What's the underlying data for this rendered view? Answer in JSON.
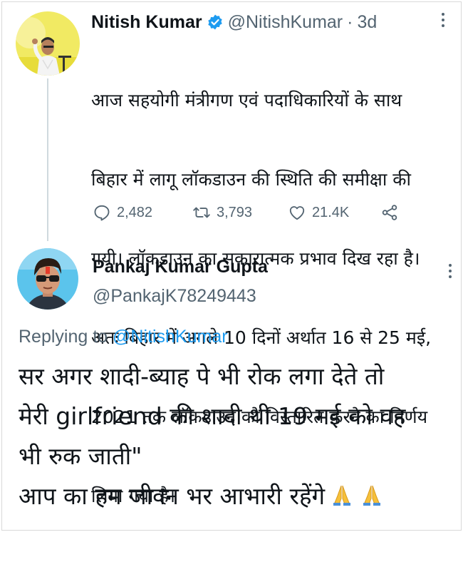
{
  "original_tweet": {
    "author_name": "Nitish Kumar",
    "handle": "@NitishKumar",
    "separator": "·",
    "time": "3d",
    "text_lines": [
      "आज सहयोगी मंत्रीगण एवं पदाधिकारियों के साथ",
      "बिहार में लागू लॉकडाउन की स्थिति की समीक्षा की",
      "गयी। लॉकडाउन का सकारात्मक प्रभाव दिख रहा है।",
      "अतः बिहार में अगले 10 दिनों अर्थात 16 से 25 मई,",
      "2021 तक लॉकडाउन को विस्तारित करने का निर्णय",
      "लिया गया है।"
    ],
    "actions": {
      "replies": "2,482",
      "retweets": "3,793",
      "likes": "21.4K"
    },
    "icons": [
      "verified-badge-icon",
      "reply-icon",
      "retweet-icon",
      "like-icon",
      "share-icon",
      "more-icon"
    ]
  },
  "reply_tweet": {
    "author_name": "Pankaj Kumar Gupta",
    "handle": "@PankajK78249443",
    "replying_prefix": "Replying to ",
    "replying_to": "@NitishKumar",
    "text_lines": [
      "सर अगर शादी-ब्याह पे भी रोक लगा देते तो",
      "मेरी girlfriend की शादी थी 19 मई को वह",
      "भी रुक जाती\"",
      "आप का हम जीवन भर आभारी रहेंगे"
    ],
    "trailing_emoji": [
      "folded-hands-icon",
      "folded-hands-icon"
    ]
  },
  "colors": {
    "accent": "#1d9bf0",
    "secondary_text": "#536471",
    "primary_text": "#0f1419",
    "verified": "#1d9bf0"
  }
}
